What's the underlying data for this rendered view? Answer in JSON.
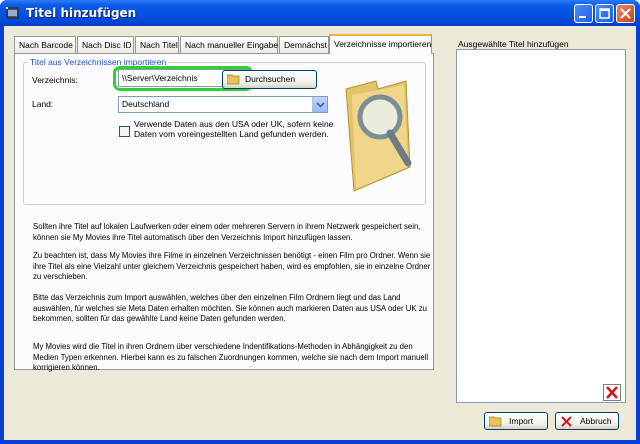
{
  "window": {
    "title": "Titel hinzufügen"
  },
  "tabs": [
    {
      "label": "Nach Barcode"
    },
    {
      "label": "Nach Disc ID"
    },
    {
      "label": "Nach Titel"
    },
    {
      "label": "Nach manueller Eingabe"
    },
    {
      "label": "Demnächst"
    },
    {
      "label": "Verzeichnisse importieren"
    }
  ],
  "group": {
    "title": "Titel aus Verzeichnissen importieren"
  },
  "form": {
    "directory_label": "Verzeichnis:",
    "directory_value": "\\\\Server\\Verzeichnis",
    "browse_label": "Durchsuchen",
    "country_label": "Land:",
    "country_value": "Deutschland",
    "checkbox_text": "Verwende Daten aus den USA oder UK, sofern keine Daten vom voreingestellten Land gefunden werden."
  },
  "paragraphs": [
    "Sollten ihre Titel auf lokalen Laufwerken oder einem oder mehreren Servern in ihrem Netzwerk gespeichert sein, können sie My Movies ihre Titel automatisch über den Verzeichnis Import hinzufügen lassen.",
    "Zu beachten ist, dass My Movies ihre Filme in einzelnen Verzeichnissen benötigt - einen Film pro Ordner. Wenn sie ihre Titel als eine Vielzahl unter gleichem Verzeichnis gespeichert haben, wird es empfohlen, sie in einzelne Ordner zu verschieben.",
    "Bitte das Verzeichnis zum Import auswählen, welches über den einzelnen Film Ordnern liegt und das Land auswählen, für welches sie Meta Daten erhalten möchten. Sie können auch markieren Daten aus USA oder UK zu bekommen, sollten für das gewählte Land keine Daten gefunden werden.",
    "My Movies wird die Titel in ihren Ordnern über verschiedene Indentifikations-Methoden in Abhängigkeit zu den Medien Typen erkennen. Hierbei kann es zu falschen Zuordnungen kommen, welche sie nach dem Import manuell korrigieren können."
  ],
  "right_panel": {
    "label": "Ausgewählte Titel hinzufügen"
  },
  "buttons": {
    "import": "Import",
    "cancel": "Abbruch"
  },
  "colors": {
    "titlebar": "#0b5ae8",
    "dialog": "#ece9d8",
    "highlight": "#30d030",
    "tab_active_accent": "#f3b03b"
  }
}
